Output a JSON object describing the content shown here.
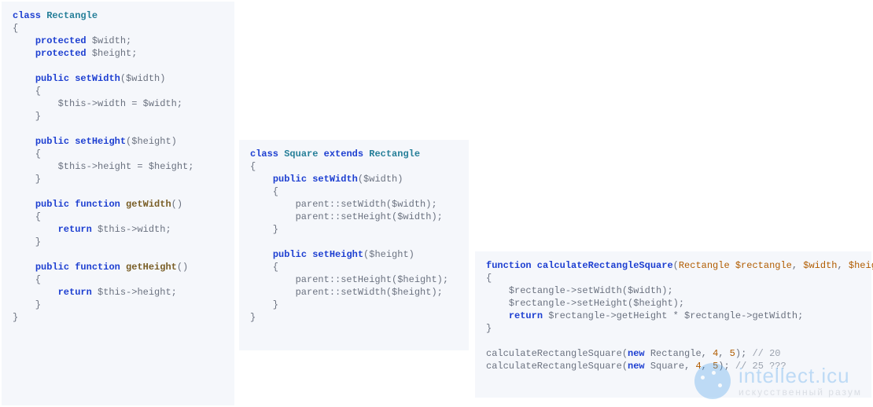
{
  "code_block_1": {
    "l1_class": "class",
    "l1_name": "Rectangle",
    "l3_protected": "protected",
    "l3_var": " $width;",
    "l4_protected": "protected",
    "l4_var": " $height;",
    "l6_public": "public",
    "l6_fn": " setWidth",
    "l6_args": "($width)",
    "l8_body": "$this->width = $width;",
    "l11_public": "public",
    "l11_fn": " setHeight",
    "l11_args": "($height)",
    "l13_body": "$this->height = $height;",
    "l16_public": "public",
    "l16_function": " function",
    "l16_fn": " getWidth",
    "l16_args": "()",
    "l18_return": "return",
    "l18_body": " $this->width;",
    "l21_public": "public",
    "l21_function": " function",
    "l21_fn": " getHeight",
    "l21_args": "()",
    "l23_return": "return",
    "l23_body": " $this->height;"
  },
  "code_block_2": {
    "l1_class": "class",
    "l1_name": " Square",
    "l1_extends": " extends",
    "l1_base": " Rectangle",
    "l3_public": "public",
    "l3_fn": " setWidth",
    "l3_args": "($width)",
    "l5_body": "parent::setWidth($width);",
    "l6_body": "parent::setHeight($width);",
    "l9_public": "public",
    "l9_fn": " setHeight",
    "l9_args": "($height)",
    "l11_body": "parent::setHeight($height);",
    "l12_body": "parent::setWidth($height);"
  },
  "code_block_3": {
    "l1_function": "function",
    "l1_fn": " calculateRectangleSquare",
    "l1_po": "(",
    "l1_p_type": "Rectangle",
    "l1_p_rect": " $rectangle",
    "l1_c1": ", ",
    "l1_p_w": "$width",
    "l1_c2": ", ",
    "l1_p_h": "$height",
    "l1_pc": ")",
    "l3_body": "$rectangle->setWidth($width);",
    "l4_body": "$rectangle->setHeight($height);",
    "l5_return": "return",
    "l5_body": " $rectangle->getHeight * $rectangle->getWidth;",
    "l8_call": "calculateRectangleSquare(",
    "l8_new": "new",
    "l8_type": " Rectangle",
    "l8_c1": ", ",
    "l8_n1": "4",
    "l8_c2": ", ",
    "l8_n2": "5",
    "l8_end": "); ",
    "l8_cm": "// 20",
    "l9_call": "calculateRectangleSquare(",
    "l9_new": "new",
    "l9_type": " Square",
    "l9_c1": ", ",
    "l9_n1": "4",
    "l9_c2": ", ",
    "l9_n2": "5",
    "l9_end": "); ",
    "l9_cm": "// 25 ???"
  },
  "watermark": {
    "main": "intellect.icu",
    "sub": "искусственный разум"
  }
}
